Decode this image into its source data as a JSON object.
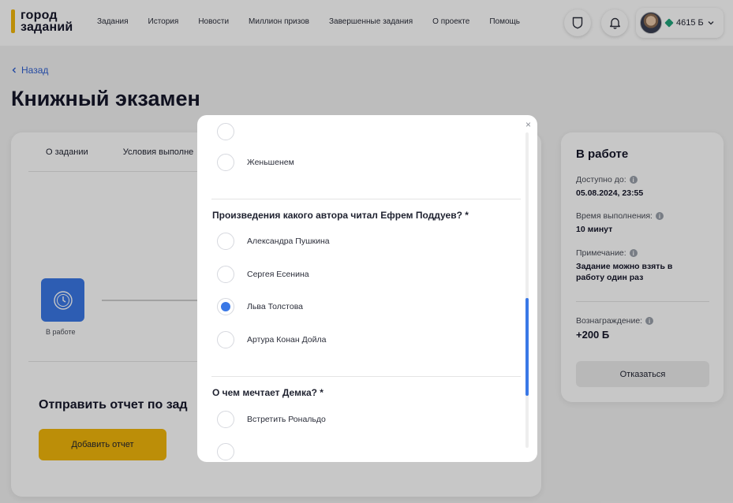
{
  "header": {
    "logo_line1": "город",
    "logo_line2": "заданий",
    "nav": [
      "Задания",
      "История",
      "Новости",
      "Миллион призов",
      "Завершенные задания",
      "О проекте",
      "Помощь"
    ],
    "balance": "4615 Б"
  },
  "page": {
    "back_label": "Назад",
    "title": "Книжный экзамен"
  },
  "main": {
    "tabs": [
      "О задании",
      "Условия выполне"
    ],
    "status_label": "В работе",
    "send_title": "Отправить отчет по зад",
    "add_report_label": "Добавить отчет"
  },
  "sidebar": {
    "title": "В работе",
    "available_label": "Доступно до:",
    "available_value": "05.08.2024, 23:55",
    "time_label": "Время выполнения:",
    "time_value": "10 минут",
    "note_label": "Примечание:",
    "note_value_line1": "Задание можно взять в",
    "note_value_line2": "работу один раз",
    "reward_label": "Вознаграждение:",
    "reward_value": "+200 Б",
    "refuse_label": "Отказаться"
  },
  "modal": {
    "close": "×",
    "prev_options": [
      "Женьшенем"
    ],
    "question1": "Произведения какого автора читал Ефрем Поддуев? *",
    "question1_options": [
      "Александра Пушкина",
      "Сергея Есенина",
      "Льва Толстова",
      "Артура Конан Дойла"
    ],
    "question1_selected": "Льва Толстова",
    "question2": "О чем мечтает Демка? *",
    "question2_options": [
      "Встретить Рональдо"
    ]
  },
  "colors": {
    "accent": "#f1b70b",
    "primary_blue": "#3a78e6"
  }
}
